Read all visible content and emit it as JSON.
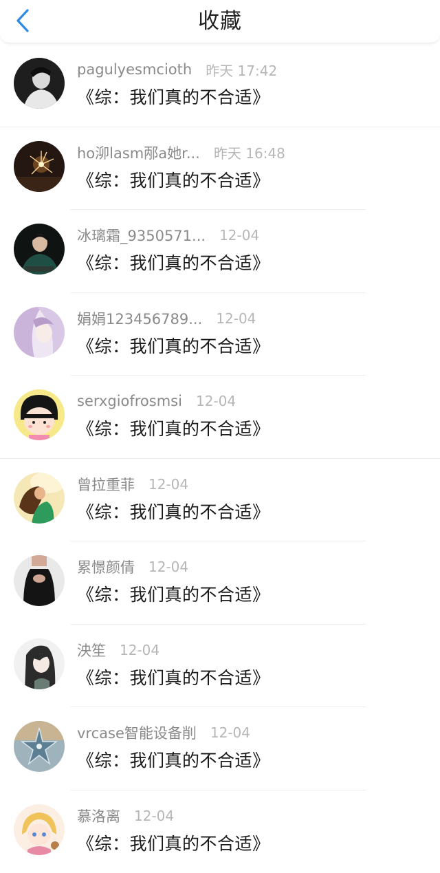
{
  "header": {
    "title": "收藏",
    "back_icon": "chevron-left-icon",
    "accent_color": "#2f8ae6"
  },
  "items": [
    {
      "user": "pagulyesmcioth",
      "time": "昨天 17:42",
      "title": "《综：我们真的不合适》"
    },
    {
      "user": "ho泖lasm邴a她r...",
      "time": "昨天 16:48",
      "title": "《综：我们真的不合适》"
    },
    {
      "user": "冰璃霜_9350571...",
      "time": "12-04",
      "title": "《综：我们真的不合适》"
    },
    {
      "user": "娟娟123456789...",
      "time": "12-04",
      "title": "《综：我们真的不合适》"
    },
    {
      "user": "serxgiofrosmsi",
      "time": "12-04",
      "title": "《综：我们真的不合适》"
    },
    {
      "user": "曾拉重菲",
      "time": "12-04",
      "title": "《综：我们真的不合适》"
    },
    {
      "user": "累憬颜倩",
      "time": "12-04",
      "title": "《综：我们真的不合适》"
    },
    {
      "user": "泱笙",
      "time": "12-04",
      "title": "《综：我们真的不合适》"
    },
    {
      "user": "vrcase智能设备削",
      "time": "12-04",
      "title": "《综：我们真的不合适》"
    },
    {
      "user": "慕洛离",
      "time": "12-04",
      "title": "《综：我们真的不合适》"
    }
  ]
}
